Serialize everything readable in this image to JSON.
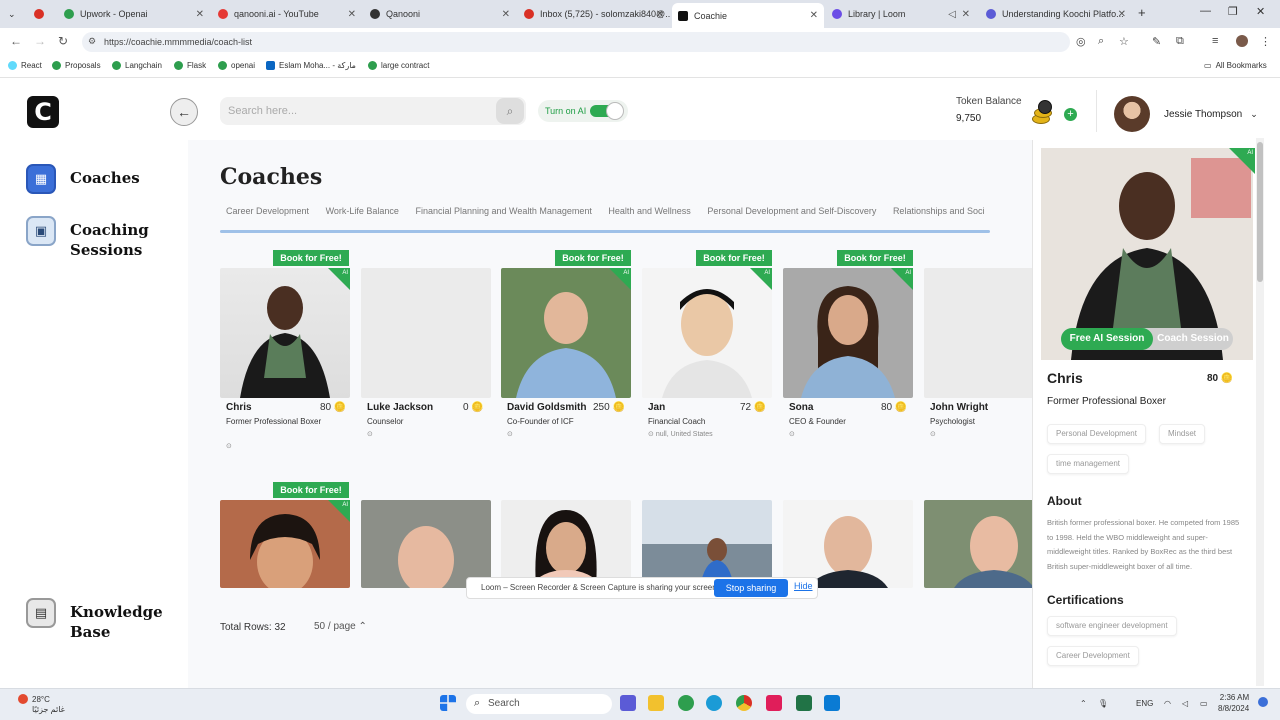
{
  "browser": {
    "tabs": [
      {
        "title": "",
        "color": "#d93025"
      },
      {
        "title": "Upwork - Openai",
        "color": "#2e9e4e"
      },
      {
        "title": "qanooni.ai - YouTube",
        "color": "#e53935"
      },
      {
        "title": "Qanooni",
        "color": "#333333"
      },
      {
        "title": "Inbox (5,725) - solomzaki840@...",
        "color": "#d93025"
      },
      {
        "title": "Coachie",
        "color": "#111111",
        "active": true
      },
      {
        "title": "Library | Loom",
        "color": "#6b4de6"
      },
      {
        "title": "Understanding Koochi Platfo...",
        "color": "#5b5bd6"
      }
    ],
    "url": "https://coachie.mmmmedia/coach-list",
    "bookmarks": [
      "React",
      "Proposals",
      "Langchain",
      "Flask",
      "openai",
      "Eslam Moha... - ماركة",
      "large contract"
    ],
    "all_bookmarks": "All Bookmarks"
  },
  "app": {
    "logo": "C",
    "sidebar": {
      "items": [
        {
          "label": "Coaches"
        },
        {
          "label": "Coaching Sessions"
        },
        {
          "label": "Knowledge Base"
        }
      ]
    },
    "search": {
      "placeholder": "Search here..."
    },
    "turn_on_ai": "Turn on AI",
    "token_balance": {
      "label": "Token Balance",
      "value": "9,750"
    },
    "user": {
      "name": "Jessie Thompson"
    }
  },
  "main": {
    "title": "Coaches",
    "categories": [
      "Career Development",
      "Work-Life Balance",
      "Financial Planning and Wealth Management",
      "Health and Wellness",
      "Personal Development and Self-Discovery",
      "Relationships and Soci"
    ],
    "book_label": "Book for Free!",
    "ai_badge": "AI",
    "coaches": [
      {
        "name": "Chris",
        "tokens": "80",
        "title": "Former Professional Boxer",
        "location": "",
        "free": true
      },
      {
        "name": "Luke Jackson",
        "tokens": "0",
        "title": "Counselor",
        "location": "",
        "free": false
      },
      {
        "name": "David Goldsmith",
        "tokens": "250",
        "title": "Co-Founder of ICF",
        "location": "",
        "free": true
      },
      {
        "name": "Jan",
        "tokens": "72",
        "title": "Financial Coach",
        "location": "null, United States",
        "free": true
      },
      {
        "name": "Sona",
        "tokens": "80",
        "title": "CEO & Founder",
        "location": "",
        "free": true
      },
      {
        "name": "John Wright",
        "tokens": "0",
        "title": "Psychologist",
        "location": "",
        "free": false
      }
    ],
    "total_rows": "Total Rows: 32",
    "per_page": "50 / page"
  },
  "panel": {
    "tab_ai": "Free AI Session",
    "tab_coach": "Coach Session",
    "name": "Chris",
    "tokens": "80",
    "title": "Former Professional Boxer",
    "tags": [
      "Personal Development",
      "Mindset",
      "time management"
    ],
    "about_heading": "About",
    "about": "British former professional boxer. He competed from 1985 to 1998. Held the WBO middleweight and super-middleweight titles. Ranked by BoxRec as the third best British super-middleweight boxer of all time.",
    "cert_heading": "Certifications",
    "certs": [
      "software engineer development",
      "Career Development"
    ]
  },
  "share_bar": {
    "text": "Loom – Screen Recorder & Screen Capture is sharing your screen.",
    "stop": "Stop sharing",
    "hide": "Hide"
  },
  "taskbar": {
    "weather_temp": "28°C",
    "weather_desc": "غائم جزئيًا",
    "search": "Search",
    "lang": "ENG",
    "time": "2:36 AM",
    "date": "8/8/2024"
  },
  "colors": {
    "accent": "#2eaa52",
    "nav_blue": "#3b6fd8",
    "share_blue": "#1c73e8"
  }
}
